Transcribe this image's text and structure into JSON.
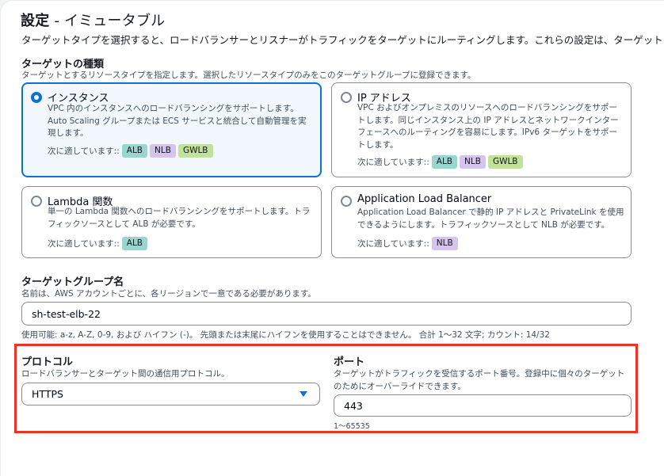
{
  "header": {
    "title": "設定",
    "title_suffix": " - イミュータブル",
    "description": "ターゲットタイプを選択すると、ロードバランサーとリスナーがトラフィックをターゲットにルーティングします。これらの設定は、ターゲット"
  },
  "target_type": {
    "label": "ターゲットの種類",
    "hint": "ターゲットとするリソースタイプを指定します。選択したリソースタイプのみをこのターゲットグループに登録できます。",
    "supports_label": "次に適しています::",
    "options": [
      {
        "title": "インスタンス",
        "selected": true,
        "description": "VPC 内のインスタンスへのロードバランシングをサポートします。Auto Scaling グループまたは ECS サービスと統合して自動管理を実現します。",
        "badges": [
          "ALB",
          "NLB",
          "GWLB"
        ]
      },
      {
        "title": "IP アドレス",
        "selected": false,
        "description": "VPC およびオンプレミスのリソースへのロードバランシングをサポートします。同じインスタンス上の IP アドレスとネットワークインターフェースへのルーティングを容易にします。IPv6 ターゲットをサポートします。",
        "badges": [
          "ALB",
          "NLB",
          "GWLB"
        ]
      },
      {
        "title": "Lambda 関数",
        "selected": false,
        "description": "単一の Lambda 関数へのロードバランシングをサポートします。トラフィックソースとして ALB が必要です。",
        "badges": [
          "ALB"
        ]
      },
      {
        "title": "Application Load Balancer",
        "selected": false,
        "description": "Application Load Balancer で静的 IP アドレスと PrivateLink を使用できるようにします。トラフィックソースとして NLB が必要です。",
        "badges": [
          "NLB"
        ]
      }
    ]
  },
  "badge_colors": {
    "ALB": "#9ad6d0",
    "NLB": "#d6c4ef",
    "GWLB": "#c1e29a"
  },
  "target_group_name": {
    "label": "ターゲットグループ名",
    "hint": "名前は、AWS アカウントごとに、各リージョンで一意である必要があります。",
    "value": "sh-test-elb-22",
    "constraint": "使用可能: a-z, A-Z, 0-9, および ハイフン (-)。 先頭または末尾にハイフンを使用することはできません。 合計 1〜32 文字; カウント: 14/32"
  },
  "protocol": {
    "label": "プロトコル",
    "hint": "ロードバランサーとターゲット間の通信用プロトコル。",
    "value": "HTTPS"
  },
  "port": {
    "label": "ポート",
    "hint_line1": "ターゲットがトラフィックを受信するポート番号。登録中に個々のターゲット",
    "hint_line2": "のためにオーバーライドできます。",
    "value": "443",
    "range": "1〜65535"
  },
  "colors": {
    "accent": "#0972d3",
    "highlight_box": "#ee3324"
  }
}
